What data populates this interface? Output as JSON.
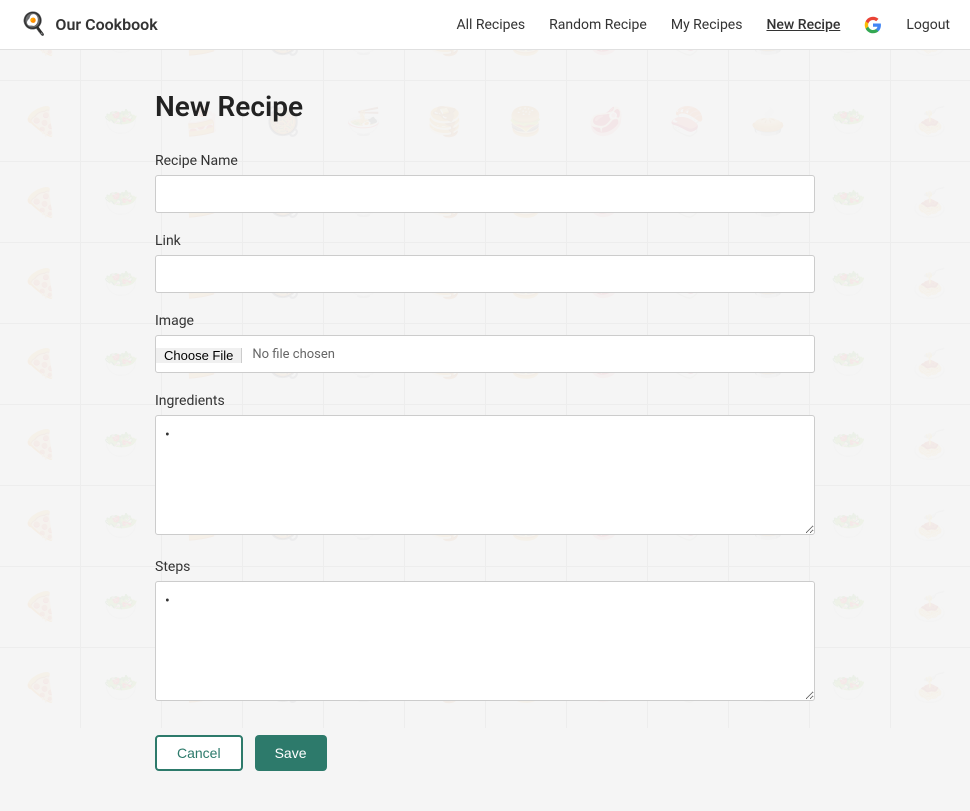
{
  "app": {
    "brand": "Our Cookbook",
    "brand_icon": "🍳"
  },
  "navbar": {
    "links": [
      {
        "label": "All Recipes",
        "active": false
      },
      {
        "label": "Random Recipe",
        "active": false
      },
      {
        "label": "My Recipes",
        "active": false
      },
      {
        "label": "New Recipe",
        "active": true
      }
    ],
    "logout_label": "Logout"
  },
  "page": {
    "title": "New Recipe"
  },
  "form": {
    "recipe_name_label": "Recipe Name",
    "recipe_name_placeholder": "",
    "link_label": "Link",
    "link_placeholder": "",
    "image_label": "Image",
    "choose_file_label": "Choose File",
    "no_file_text": "No file chosen",
    "ingredients_label": "Ingredients",
    "steps_label": "Steps"
  },
  "actions": {
    "cancel_label": "Cancel",
    "save_label": "Save"
  },
  "bg_icons": [
    "🍕",
    "🥗",
    "🍰",
    "🥘",
    "🍜",
    "🥞",
    "🍔",
    "🥩",
    "🍣",
    "🥧",
    "🥗",
    "🍝",
    "🍕",
    "🥗",
    "🍰",
    "🥘",
    "🍜",
    "🥞",
    "🍔",
    "🥩",
    "🍣",
    "🥧",
    "🥗",
    "🍝",
    "🍕",
    "🥗",
    "🍰",
    "🥘",
    "🍜",
    "🥞",
    "🍔",
    "🥩",
    "🍣",
    "🥧",
    "🥗",
    "🍝",
    "🍕",
    "🥗",
    "🍰",
    "🥘",
    "🍜",
    "🥞",
    "🍔",
    "🥩",
    "🍣",
    "🥧",
    "🥗",
    "🍝",
    "🍕",
    "🥗",
    "🍰",
    "🥘",
    "🍜",
    "🥞",
    "🍔",
    "🥩",
    "🍣",
    "🥧",
    "🥗",
    "🍝",
    "🍕",
    "🥗",
    "🍰",
    "🥘",
    "🍜",
    "🥞",
    "🍔",
    "🥩",
    "🍣",
    "🥧",
    "🥗",
    "🍝",
    "🍕",
    "🥗",
    "🍰",
    "🥘",
    "🍜",
    "🥞",
    "🍔",
    "🥩",
    "🍣",
    "🥧",
    "🥗",
    "🍝",
    "🍕",
    "🥗",
    "🍰",
    "🥘",
    "🍜",
    "🥞",
    "🍔",
    "🥩",
    "🍣",
    "🥧",
    "🥗",
    "🍝",
    "🍕",
    "🥗",
    "🍰",
    "🥘",
    "🍜",
    "🥞",
    "🍔",
    "🥩",
    "🍣",
    "🥧",
    "🥗",
    "🍝"
  ]
}
